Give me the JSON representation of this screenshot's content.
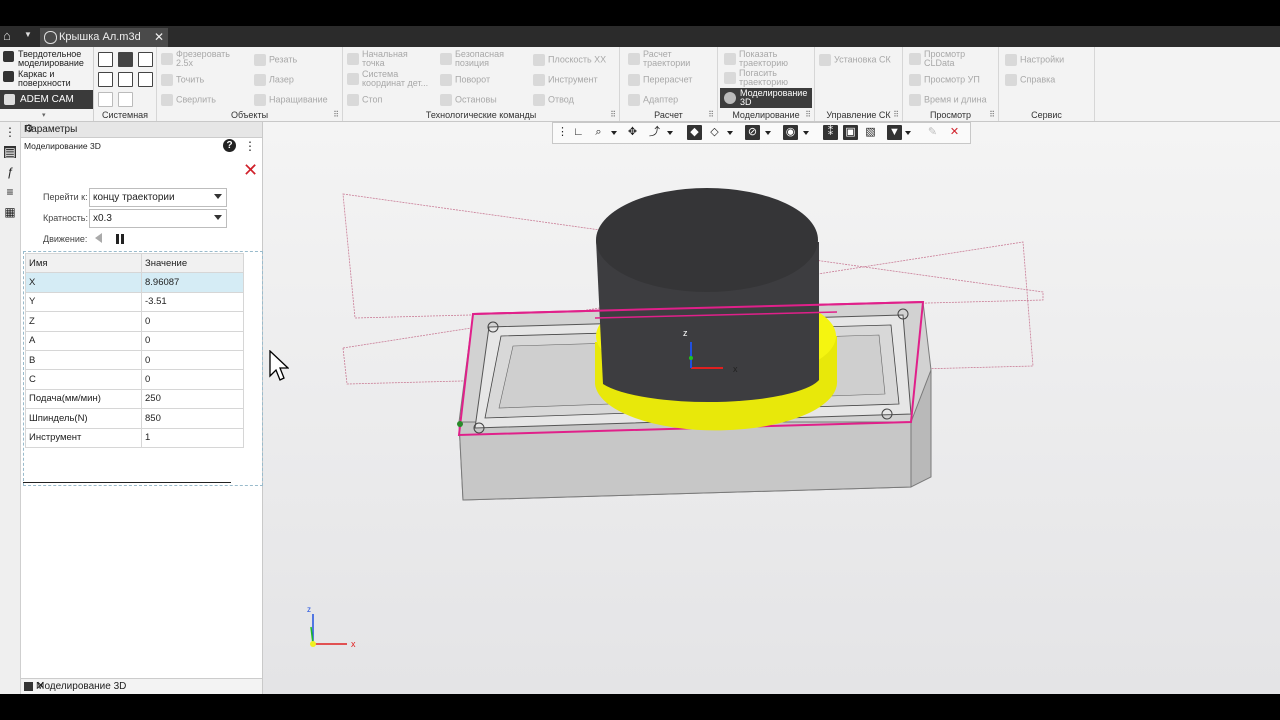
{
  "window": {
    "tab_title": "Крышка Ал.m3d",
    "tab_close": "✕"
  },
  "ribbon": {
    "left_items": [
      "Твердотельное моделирование",
      "Каркас и поверхности"
    ],
    "adem_cam": "ADEM CAM",
    "groups": {
      "system": "Системная",
      "objects": "Объекты",
      "tech": "Технологические команды",
      "calc": "Расчет",
      "modeling": "Моделирование",
      "cs": "Управление СК",
      "view": "Просмотр",
      "service": "Сервис"
    },
    "objects_items": {
      "mill": "Фрезеровать 2.5x",
      "turn": "Точить",
      "drill": "Сверлить",
      "cut": "Резать",
      "laser": "Лазер",
      "build": "Наращивание"
    },
    "tech_items": {
      "start_point": "Начальная точка",
      "coord_system": "Система координат дет...",
      "stop": "Стоп",
      "safe_pos": "Безопасная позиция",
      "rotate": "Поворот",
      "stops": "Остановы",
      "plane_xx": "Плоскость XX",
      "tool": "Инструмент",
      "retract": "Отвод"
    },
    "calc_items": {
      "calc_traj": "Расчет траектории",
      "recalc": "Перерасчет",
      "adapter": "Адаптер"
    },
    "modeling_items": {
      "show_traj": "Показать траекторию",
      "hide_traj": "Погасить траекторию",
      "model3d": "Моделирование 3D"
    },
    "cs_items": {
      "install_cs": "Установка СК"
    },
    "view_items": {
      "view_cldata": "Просмотр CLData",
      "view_up": "Просмотр УП",
      "time_length": "Время и длина"
    },
    "service_items": {
      "settings": "Настройки",
      "help": "Справка"
    }
  },
  "panel": {
    "header": "Параметры",
    "title": "Моделирование 3D",
    "goto_label": "Перейти к:",
    "goto_value": "концу траектории",
    "multiplicity_label": "Кратность:",
    "multiplicity_value": "x0.3",
    "motion_label": "Движение:",
    "table": {
      "col_name": "Имя",
      "col_value": "Значение",
      "rows": [
        {
          "name": "X",
          "value": "8.96087"
        },
        {
          "name": "Y",
          "value": "-3.51"
        },
        {
          "name": "Z",
          "value": "0"
        },
        {
          "name": "A",
          "value": "0"
        },
        {
          "name": "B",
          "value": "0"
        },
        {
          "name": "C",
          "value": "0"
        },
        {
          "name": "Подача(мм/мин)",
          "value": "250"
        },
        {
          "name": "Шпиндель(N)",
          "value": "850"
        },
        {
          "name": "Инструмент",
          "value": "1"
        }
      ]
    },
    "footer": "Моделирование 3D"
  },
  "viewport": {
    "axis_x": "x",
    "axis_z": "z",
    "colors": {
      "tool_body": "#3a3a3c",
      "holder": "#f2f20a",
      "outline": "#e0208a",
      "part": "#cfcfcf"
    }
  }
}
